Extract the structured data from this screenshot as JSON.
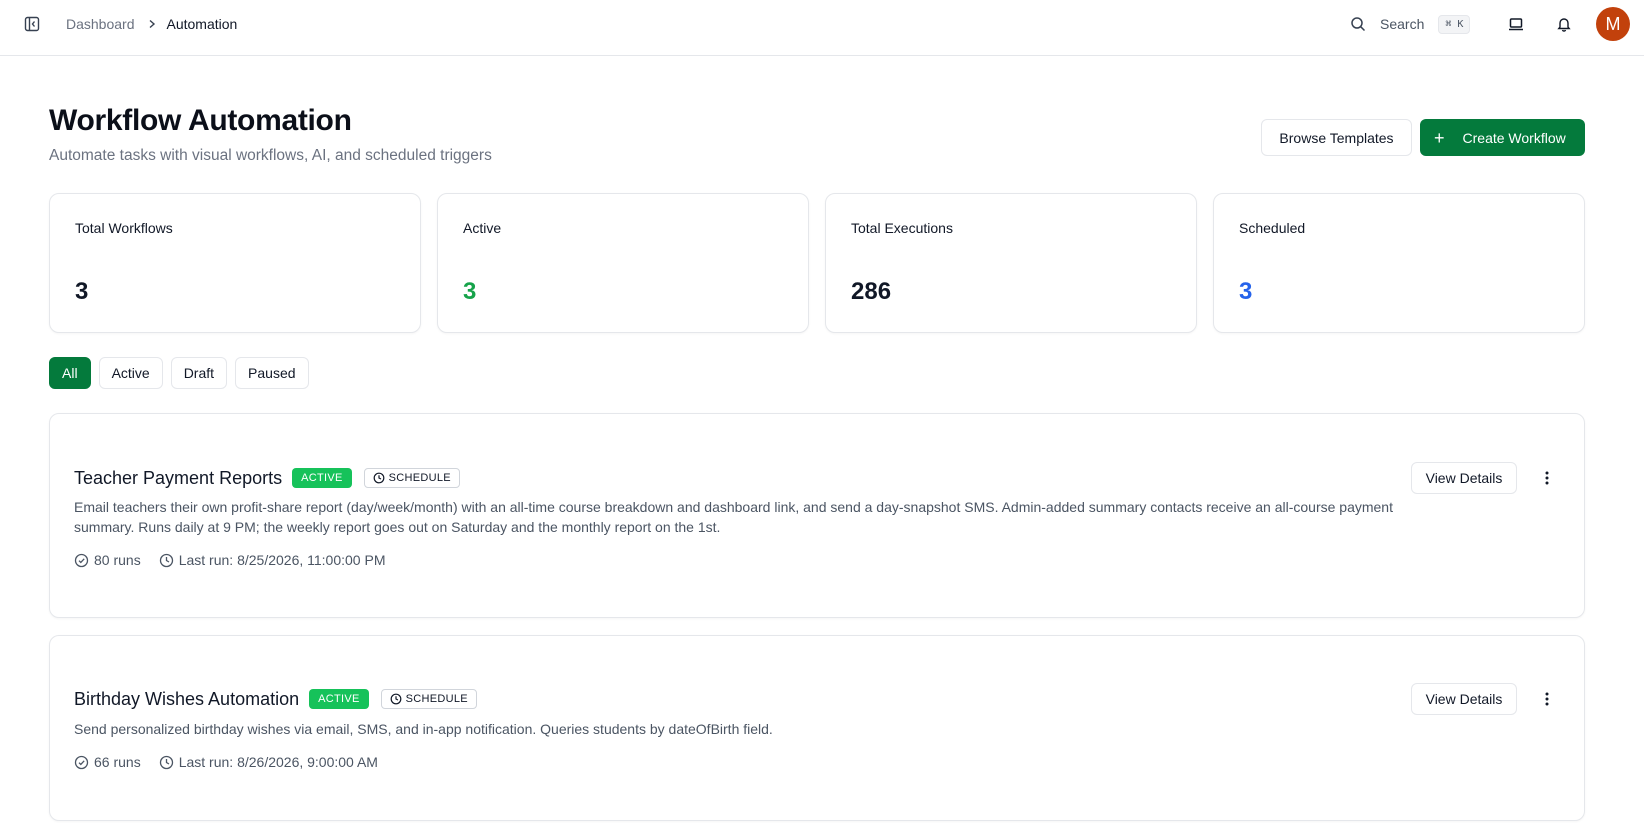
{
  "breadcrumb": {
    "parent": "Dashboard",
    "current": "Automation"
  },
  "topbar": {
    "search_label": "Search",
    "search_shortcut": "⌘ K",
    "avatar_initial": "M"
  },
  "header": {
    "title": "Workflow Automation",
    "subtitle": "Automate tasks with visual workflows, AI, and scheduled triggers",
    "browse_label": "Browse Templates",
    "create_label": "Create Workflow"
  },
  "stats": [
    {
      "label": "Total Workflows",
      "value": "3",
      "color": "#111827"
    },
    {
      "label": "Active",
      "value": "3",
      "color": "#16a34a"
    },
    {
      "label": "Total Executions",
      "value": "286",
      "color": "#111827"
    },
    {
      "label": "Scheduled",
      "value": "3",
      "color": "#2563eb"
    }
  ],
  "filters": [
    "All",
    "Active",
    "Draft",
    "Paused"
  ],
  "workflows": [
    {
      "title": "Teacher Payment Reports",
      "status": "ACTIVE",
      "type": "SCHEDULE",
      "description": "Email teachers their own profit-share report (day/week/month) with an all-time course breakdown and dashboard link, and send a day-snapshot SMS. Admin-added summary contacts receive an all-course payment summary. Runs daily at 9 PM; the weekly report goes out on Saturday and the monthly report on the 1st.",
      "runs": "80 runs",
      "last_run": "Last run: 8/25/2026, 11:00:00 PM",
      "details_label": "View Details"
    },
    {
      "title": "Birthday Wishes Automation",
      "status": "ACTIVE",
      "type": "SCHEDULE",
      "description": "Send personalized birthday wishes via email, SMS, and in-app notification. Queries students by dateOfBirth field.",
      "runs": "66 runs",
      "last_run": "Last run: 8/26/2026, 9:00:00 AM",
      "details_label": "View Details"
    }
  ],
  "colors": {
    "primary": "#047a3c",
    "active_badge": "#16c25a",
    "avatar": "#c2410c"
  }
}
